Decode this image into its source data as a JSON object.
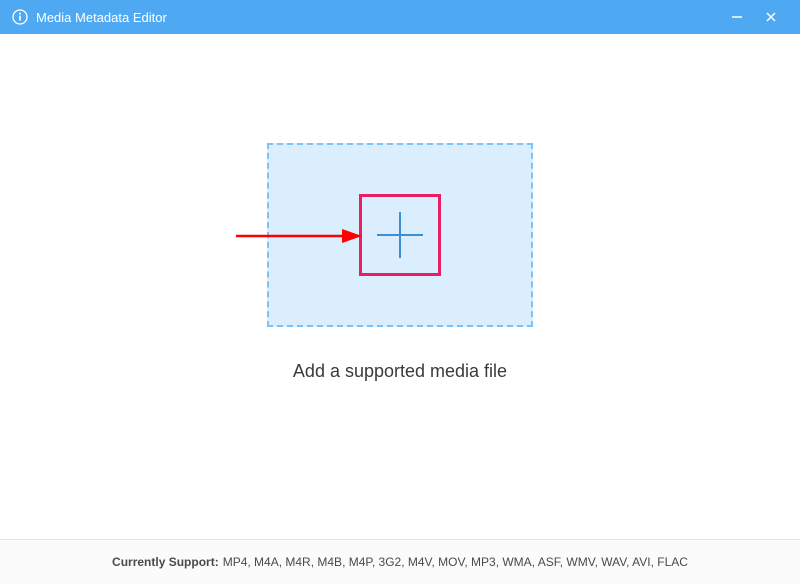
{
  "titlebar": {
    "app_title": "Media Metadata Editor"
  },
  "main": {
    "caption": "Add a supported media file"
  },
  "footer": {
    "label": "Currently Support:",
    "formats": "MP4, M4A, M4R, M4B, M4P, 3G2, M4V, MOV, MP3, WMA, ASF, WMV, WAV, AVI, FLAC"
  },
  "icons": {
    "info": "info-icon",
    "minimize": "minimize-icon",
    "close": "close-icon",
    "plus": "plus-icon"
  },
  "colors": {
    "titlebar": "#4ea9f2",
    "dropzone_bg": "#dbeefd",
    "dropzone_border": "#7fc1f5",
    "highlight": "#e91e63",
    "arrow": "#ff0000",
    "plus": "#3a8fd6"
  }
}
